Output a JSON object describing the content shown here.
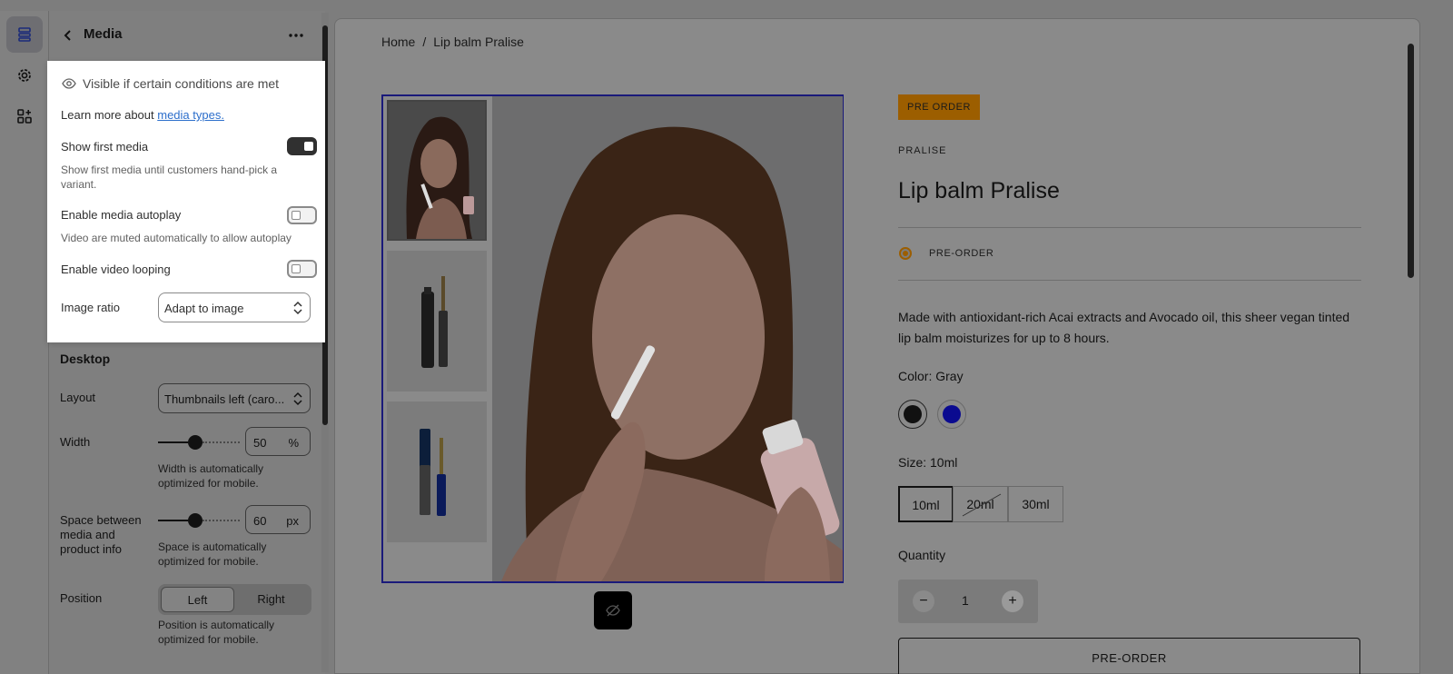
{
  "panel": {
    "title": "Media",
    "conditions_text": "Visible if certain conditions are met",
    "learn_prefix": "Learn more about ",
    "learn_link": "media types.",
    "show_first_media": {
      "label": "Show first media",
      "hint": "Show first media until customers hand-pick a variant.",
      "on": true
    },
    "autoplay": {
      "label": "Enable media autoplay",
      "hint": "Video are muted automatically to allow autoplay",
      "on": false
    },
    "looping": {
      "label": "Enable video looping",
      "on": false
    },
    "image_ratio": {
      "label": "Image ratio",
      "value": "Adapt to image"
    },
    "desktop_heading": "Desktop",
    "layout": {
      "label": "Layout",
      "value": "Thumbnails left (caro..."
    },
    "width": {
      "label": "Width",
      "value": "50",
      "unit": "%",
      "hint1": "Width is automatically",
      "hint2": "optimized for mobile.",
      "level": 0.45
    },
    "space": {
      "label1": "Space between",
      "label2": "media and",
      "label3": "product info",
      "value": "60",
      "unit": "px",
      "hint1": "Space is automatically",
      "hint2": "optimized for mobile.",
      "level": 0.45
    },
    "position": {
      "label": "Position",
      "left": "Left",
      "right": "Right",
      "selected": "Left",
      "hint1": "Position is automatically",
      "hint2": "optimized for mobile."
    }
  },
  "preview": {
    "breadcrumb": {
      "home": "Home",
      "sep": "/",
      "current": "Lip balm Pralise"
    },
    "badge": "PRE ORDER",
    "vendor": "PRALISE",
    "title": "Lip balm Pralise",
    "status": "PRE-ORDER",
    "description": "Made with antioxidant-rich Acai extracts and Avocado oil, this sheer vegan tinted lip balm moisturizes for up to 8 hours.",
    "color_label": "Color: Gray",
    "swatches": [
      "#111111",
      "#0a0a90"
    ],
    "size_label": "Size: 10ml",
    "sizes": [
      "10ml",
      "20ml",
      "30ml"
    ],
    "quantity_label": "Quantity",
    "quantity": "1",
    "buy_label": "PRE-ORDER"
  },
  "colors": {
    "accent": "#9c5e00",
    "link": "#2c6ecb",
    "selection": "#1a1a7a"
  },
  "icons": [
    "sections-icon",
    "gear-icon",
    "apps-icon",
    "back-icon",
    "more-icon",
    "eye-icon",
    "chevron-updown-icon",
    "eye-slash-icon",
    "minus-icon",
    "plus-icon"
  ]
}
